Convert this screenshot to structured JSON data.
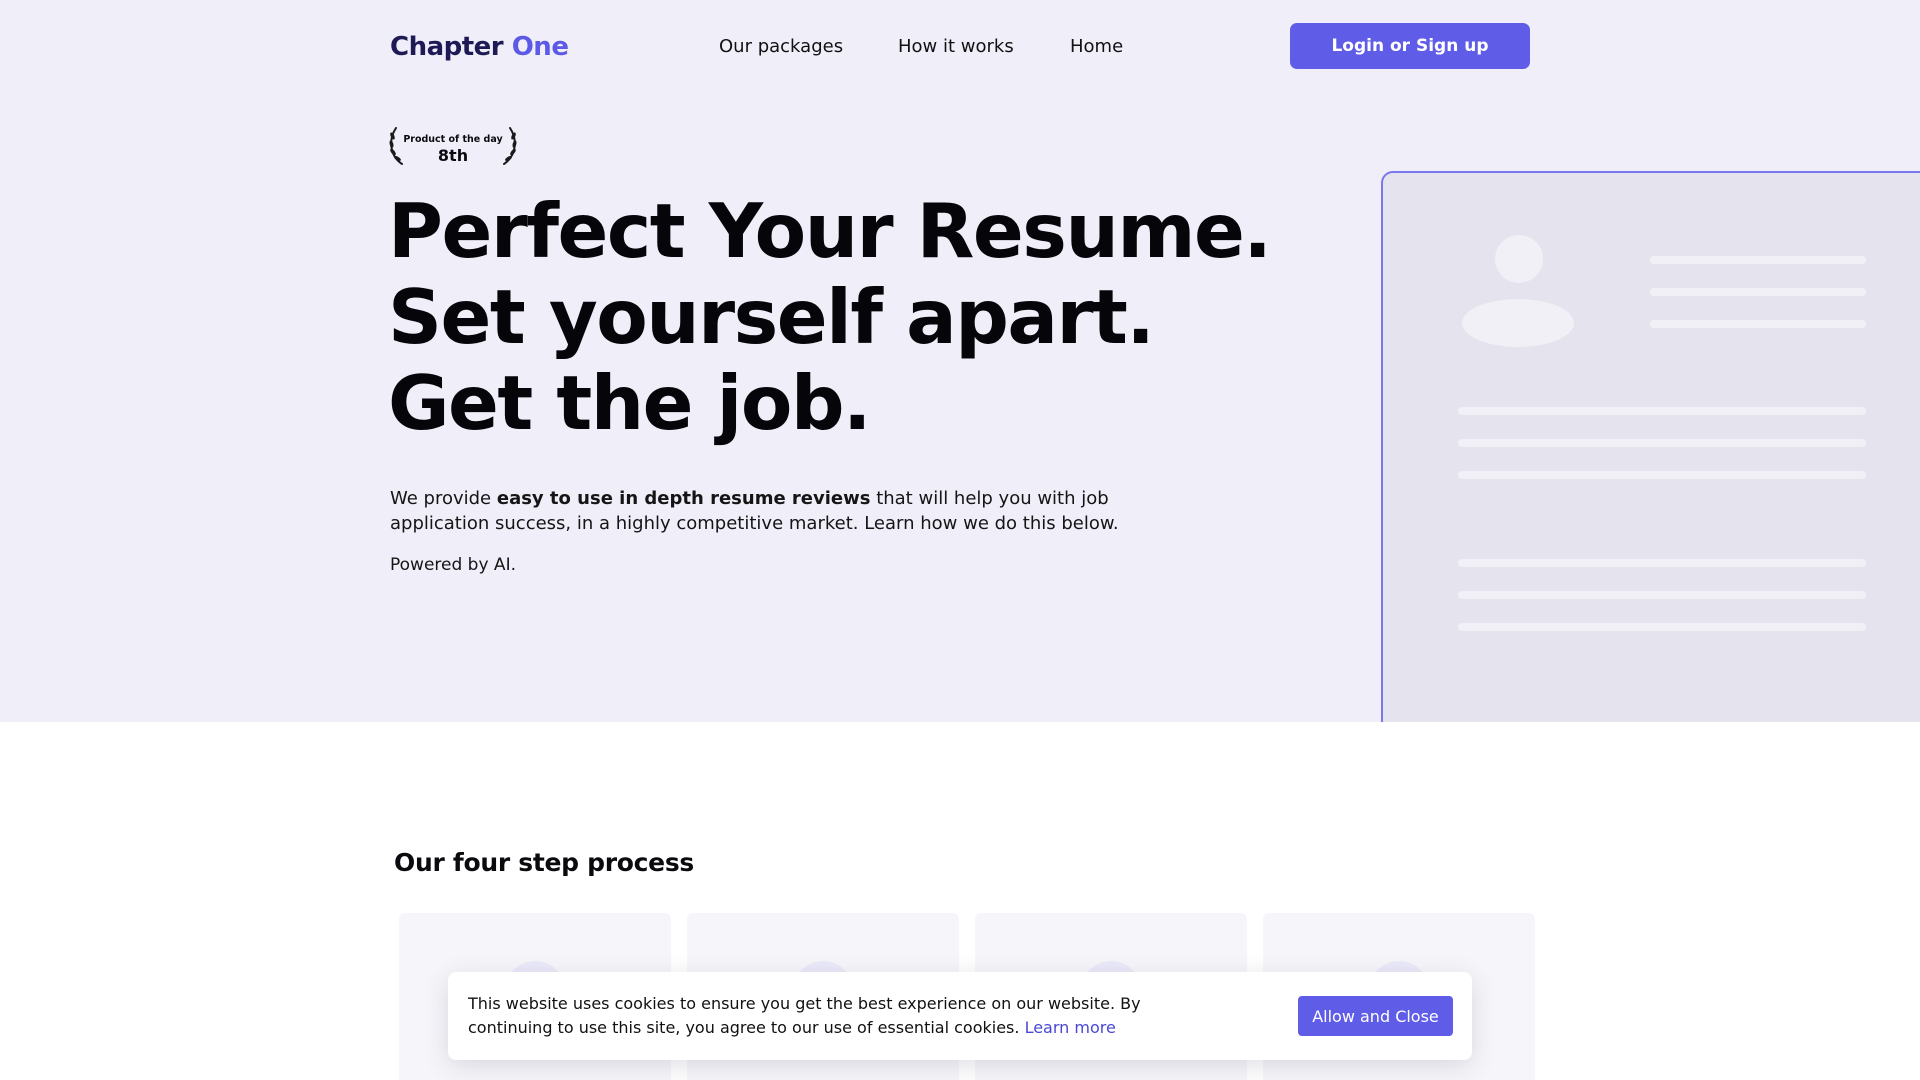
{
  "logo": {
    "part1": "Chapter",
    "part2": "One"
  },
  "nav": {
    "packages": "Our packages",
    "how": "How it works",
    "home": "Home"
  },
  "login_label": "Login or Sign up",
  "award": {
    "label": "Product of the day",
    "rank": "8th"
  },
  "headline": {
    "line1": "Perfect Your Resume.",
    "line2": "Set yourself apart.",
    "line3": "Get the job."
  },
  "description": {
    "pre": "We provide ",
    "bold": "easy to use in depth resume reviews",
    "post": " that will help you with job application success, in a highly competitive market. Learn how we do this below."
  },
  "powered": "Powered by AI.",
  "process_title": "Our four step process",
  "cookie": {
    "text": "This website uses cookies to ensure you get the best experience on our website. By continuing to use this site, you agree to our use of essential cookies.",
    "link": "Learn more",
    "button": "Allow and Close"
  },
  "colors": {
    "accent": "#5f5ce8",
    "hero_bg": "#efeef9",
    "logo_dark": "#1d1a55"
  }
}
